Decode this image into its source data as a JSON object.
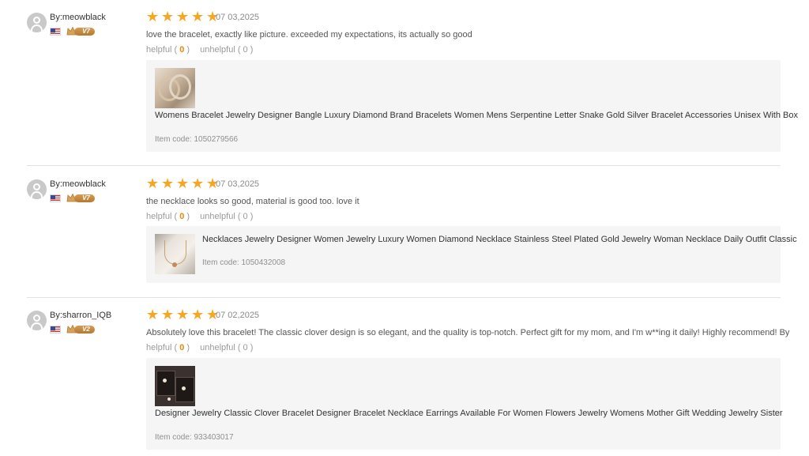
{
  "reviews": [
    {
      "username": "By:meowblack",
      "vip_level": "V7",
      "rating": 5,
      "date": "07 03,2025",
      "text": "love the bracelet, exactly like picture. exceeded my expectations, its actually so good",
      "helpful_label": "helpful (",
      "helpful_count": "0",
      "helpful_close": " )",
      "unhelpful_label": "unhelpful ( 0 )",
      "product": {
        "title": "Womens Bracelet Jewelry Designer Bangle Luxury Diamond Brand Bracelets Women Mens Serpentine Letter Snake Gold Silver Bracelet Accessories Unisex With Box",
        "item_code": "Item code: 1050279566",
        "thumbnail": "bracelet-photo"
      }
    },
    {
      "username": "By:meowblack",
      "vip_level": "V7",
      "rating": 5,
      "date": "07 03,2025",
      "text": "the necklace looks so good, material is good too. love it",
      "helpful_label": "helpful (",
      "helpful_count": "0",
      "helpful_close": " )",
      "unhelpful_label": "unhelpful ( 0 )",
      "product": {
        "title": "Necklaces Jewelry Designer Women Jewelry Luxury Women Diamond Necklace Stainless Steel Plated Gold Jewelry Woman Necklace Daily Outfit Classic",
        "item_code": "Item code: 1050432008",
        "thumbnail": "necklace-photo"
      }
    },
    {
      "username": "By:sharron_IQB",
      "vip_level": "V2",
      "rating": 5,
      "date": "07 02,2025",
      "text": "Absolutely love this bracelet! The classic clover design is so elegant, and the quality is top-notch. Perfect gift for my mom, and I'm w**ing it daily! Highly recommend! By",
      "helpful_label": "helpful (",
      "helpful_count": "0",
      "helpful_close": " )",
      "unhelpful_label": "unhelpful ( 0 )",
      "product": {
        "title": "Designer Jewelry Classic Clover Bracelet Designer Bracelet Necklace Earrings Available For Women Flowers Jewelry Womens Mother Gift Wedding Jewelry Sister",
        "item_code": "Item code: 933403017",
        "thumbnail": "clover-jewelry-photo"
      }
    }
  ],
  "colors": {
    "star": "#f6a623",
    "helpful_count": "#e58a0f",
    "product_box_bg": "#f5f5f5",
    "vip_badge": "#c58a40"
  },
  "icons": {
    "avatar": "user-avatar-icon",
    "flag": "us-flag-icon",
    "vip": "crown-icon",
    "star": "star-icon"
  }
}
